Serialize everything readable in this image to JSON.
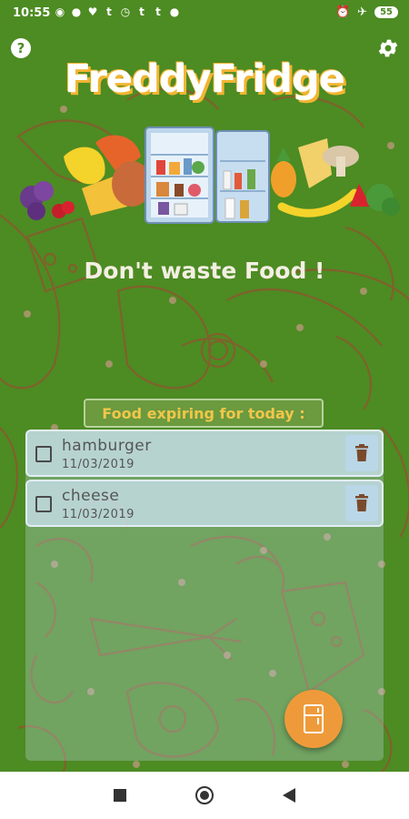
{
  "status_bar": {
    "time": "10:55",
    "battery": "55",
    "left_icons": [
      "notification-icon",
      "dot-icon",
      "twitter-icon",
      "tumblr-icon",
      "clock-icon",
      "tumblr-icon",
      "tumblr-icon",
      "dot-icon"
    ],
    "right_icons": [
      "alarm-icon",
      "airplane-icon",
      "battery-icon"
    ]
  },
  "header": {
    "title": "FreddyFridge",
    "tagline": "Don't waste Food !"
  },
  "section": {
    "title": "Food expiring for today :"
  },
  "items": [
    {
      "name": "hamburger",
      "date": "11/03/2019",
      "checked": false
    },
    {
      "name": "cheese",
      "date": "11/03/2019",
      "checked": false
    }
  ],
  "colors": {
    "background": "#4d8b23",
    "title_shadow": "#f2b531",
    "section_text": "#f2c64a",
    "fab": "#ef9a3a",
    "delete_icon": "#7a4a2c"
  }
}
